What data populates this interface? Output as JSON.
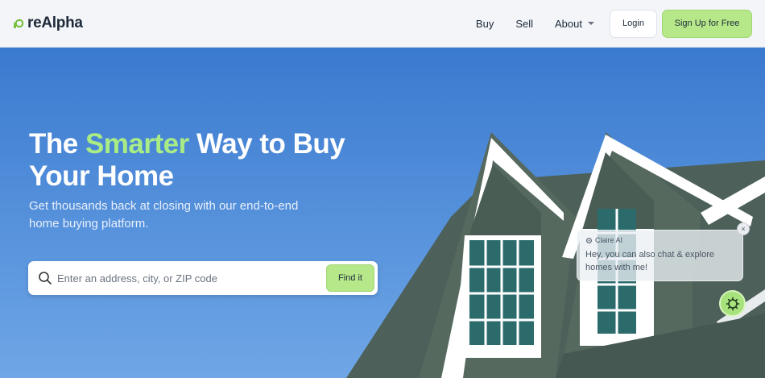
{
  "header": {
    "logo_text": "reAlpha",
    "nav": {
      "buy": "Buy",
      "sell": "Sell",
      "about": "About"
    },
    "login_label": "Login",
    "signup_label": "Sign Up for Free"
  },
  "hero": {
    "headline_part1": "The ",
    "headline_accent": "Smarter",
    "headline_part2": " Way to Buy Your Home",
    "subtext": "Get thousands back at closing with our end-to-end home buying platform.",
    "search_placeholder": "Enter an address, city, or ZIP code",
    "search_value": "",
    "find_label": "Find it"
  },
  "chat": {
    "name": "Claire AI",
    "message": "Hey, you can also chat & explore homes with me!",
    "close_glyph": "×"
  },
  "colors": {
    "brand_green": "#b6e88a",
    "accent_text": "#a9ec86",
    "sky_blue": "#4a86d4",
    "roof_green": "#4b5f58"
  },
  "icons": [
    "logo-icon",
    "chevron-down-icon",
    "search-icon",
    "sparkle-icon",
    "close-icon",
    "chat-launcher-icon"
  ]
}
